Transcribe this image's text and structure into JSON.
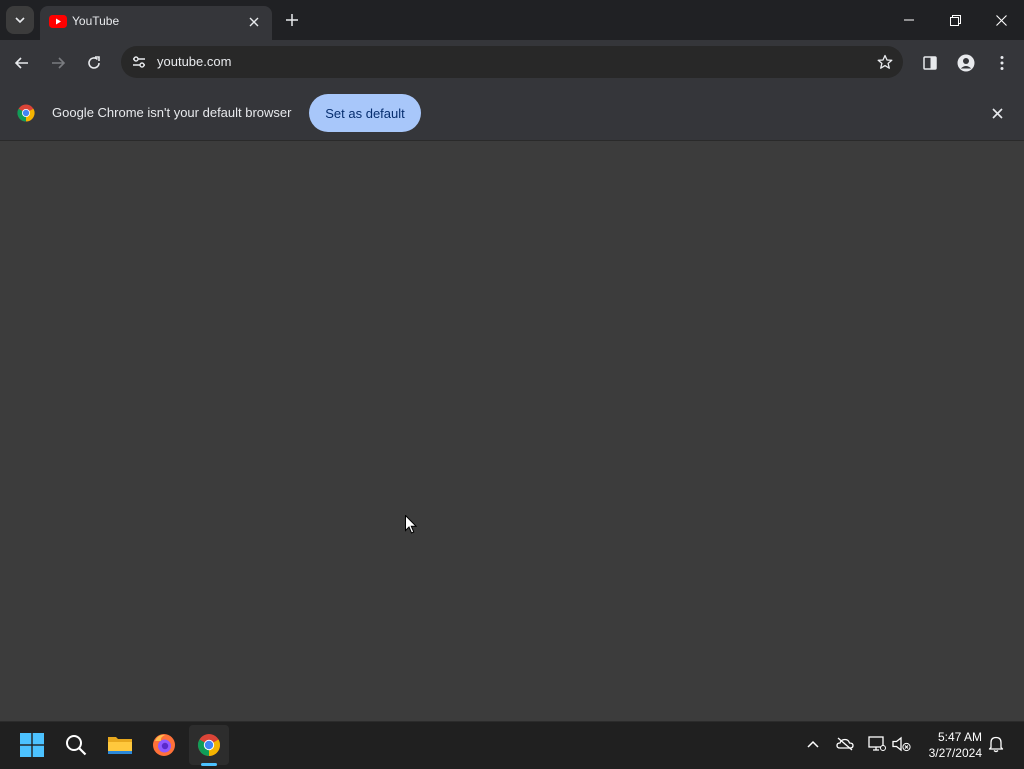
{
  "tab": {
    "title": "YouTube"
  },
  "omnibox": {
    "url": "youtube.com"
  },
  "infobar": {
    "message": "Google Chrome isn't your default browser",
    "button_label": "Set as default"
  },
  "clock": {
    "time": "5:47 AM",
    "date": "3/27/2024"
  },
  "colors": {
    "accent_button": "#a8c7fa",
    "background": "#3c3c3c",
    "taskbar_indicator": "#4cc2ff"
  },
  "icons": {
    "titlebar": [
      "tab-search-icon",
      "youtube-favicon-icon",
      "close-icon",
      "new-tab-icon",
      "minimize-icon",
      "restore-icon",
      "close-window-icon"
    ],
    "toolbar": [
      "back-arrow-icon",
      "forward-arrow-icon",
      "reload-icon",
      "site-info-icon",
      "bookmark-star-icon",
      "side-panel-icon",
      "profile-icon",
      "more-menu-icon"
    ],
    "taskbar": [
      "windows-start-icon",
      "search-icon",
      "file-explorer-icon",
      "firefox-icon",
      "chrome-icon"
    ],
    "tray": [
      "chevron-up-icon",
      "onedrive-icon",
      "network-icon",
      "volume-muted-icon",
      "notification-bell-icon"
    ]
  }
}
